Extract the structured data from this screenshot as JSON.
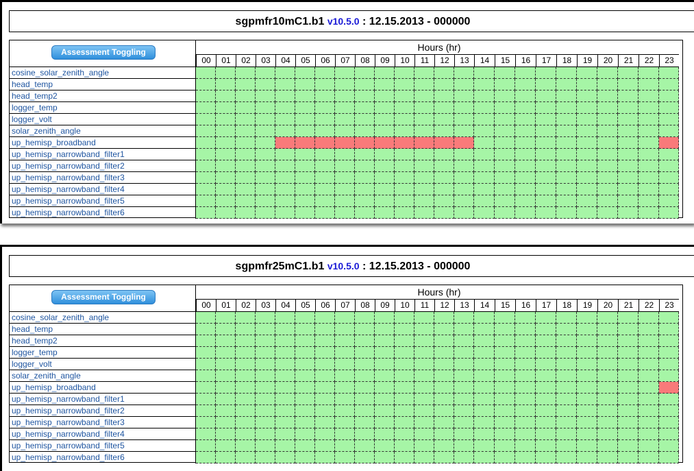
{
  "hours_label": "Hours (hr)",
  "toggle_label": "Assessment Toggling",
  "hours": [
    "00",
    "01",
    "02",
    "03",
    "04",
    "05",
    "06",
    "07",
    "08",
    "09",
    "10",
    "11",
    "12",
    "13",
    "14",
    "15",
    "16",
    "17",
    "18",
    "19",
    "20",
    "21",
    "22",
    "23"
  ],
  "colors": {
    "ok": "#a6f5a6",
    "flagged": "#f97a7a"
  },
  "panels": [
    {
      "title": {
        "datastream": "sgpmfr10mC1.b1",
        "version": "v10.5.0",
        "sep": " : ",
        "date_run": "12.15.2013 - 000000"
      },
      "variables": [
        {
          "name": "cosine_solar_zenith_angle",
          "flagged_hours": []
        },
        {
          "name": "head_temp",
          "flagged_hours": []
        },
        {
          "name": "head_temp2",
          "flagged_hours": []
        },
        {
          "name": "logger_temp",
          "flagged_hours": []
        },
        {
          "name": "logger_volt",
          "flagged_hours": []
        },
        {
          "name": "solar_zenith_angle",
          "flagged_hours": []
        },
        {
          "name": "up_hemisp_broadband",
          "flagged_hours": [
            4,
            5,
            6,
            7,
            8,
            9,
            10,
            11,
            12,
            13,
            23
          ]
        },
        {
          "name": "up_hemisp_narrowband_filter1",
          "flagged_hours": []
        },
        {
          "name": "up_hemisp_narrowband_filter2",
          "flagged_hours": []
        },
        {
          "name": "up_hemisp_narrowband_filter3",
          "flagged_hours": []
        },
        {
          "name": "up_hemisp_narrowband_filter4",
          "flagged_hours": []
        },
        {
          "name": "up_hemisp_narrowband_filter5",
          "flagged_hours": []
        },
        {
          "name": "up_hemisp_narrowband_filter6",
          "flagged_hours": []
        }
      ]
    },
    {
      "title": {
        "datastream": "sgpmfr25mC1.b1",
        "version": "v10.5.0",
        "sep": " : ",
        "date_run": "12.15.2013 - 000000"
      },
      "variables": [
        {
          "name": "cosine_solar_zenith_angle",
          "flagged_hours": []
        },
        {
          "name": "head_temp",
          "flagged_hours": []
        },
        {
          "name": "head_temp2",
          "flagged_hours": []
        },
        {
          "name": "logger_temp",
          "flagged_hours": []
        },
        {
          "name": "logger_volt",
          "flagged_hours": []
        },
        {
          "name": "solar_zenith_angle",
          "flagged_hours": []
        },
        {
          "name": "up_hemisp_broadband",
          "flagged_hours": [
            23
          ]
        },
        {
          "name": "up_hemisp_narrowband_filter1",
          "flagged_hours": []
        },
        {
          "name": "up_hemisp_narrowband_filter2",
          "flagged_hours": []
        },
        {
          "name": "up_hemisp_narrowband_filter3",
          "flagged_hours": []
        },
        {
          "name": "up_hemisp_narrowband_filter4",
          "flagged_hours": []
        },
        {
          "name": "up_hemisp_narrowband_filter5",
          "flagged_hours": []
        },
        {
          "name": "up_hemisp_narrowband_filter6",
          "flagged_hours": []
        }
      ]
    }
  ]
}
